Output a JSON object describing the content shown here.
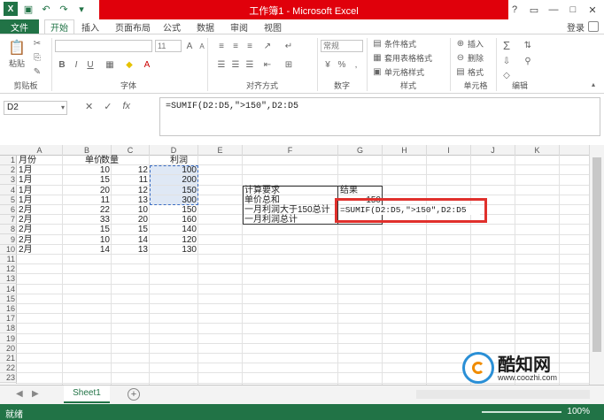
{
  "window": {
    "title": "工作簿1 - Microsoft Excel",
    "signin": "登录"
  },
  "tabs": [
    "文件",
    "开始",
    "插入",
    "页面布局",
    "公式",
    "数据",
    "审阅",
    "视图"
  ],
  "ribbon": {
    "clipboard": {
      "paste": "粘贴",
      "label": "剪贴板"
    },
    "font": {
      "size": "11",
      "label": "字体"
    },
    "alignment": {
      "label": "对齐方式"
    },
    "number": {
      "format": "常规",
      "label": "数字"
    },
    "styles": {
      "conditional": "条件格式",
      "table": "套用表格格式",
      "cell": "单元格样式",
      "label": "样式"
    },
    "cells": {
      "insert": "插入",
      "delete": "删除",
      "format": "格式",
      "label": "单元格"
    },
    "editing": {
      "label": "编辑"
    }
  },
  "formula_bar": {
    "namebox": "D2",
    "formula": "=SUMIF(D2:D5,\">150\",D2:D5"
  },
  "grid": {
    "columns": [
      "A",
      "B",
      "C",
      "D",
      "E",
      "F",
      "G",
      "H",
      "I",
      "J",
      "K"
    ],
    "rows": [
      "1",
      "2",
      "3",
      "4",
      "5",
      "6",
      "7",
      "8",
      "9",
      "10",
      "11",
      "12",
      "13",
      "14",
      "15",
      "16",
      "17",
      "18",
      "19",
      "20",
      "21",
      "22",
      "23"
    ],
    "data": {
      "headers": [
        "月份",
        "单价",
        "数量",
        "利润"
      ],
      "records": [
        [
          "1月",
          "10",
          "12",
          "100"
        ],
        [
          "1月",
          "15",
          "11",
          "200"
        ],
        [
          "1月",
          "20",
          "12",
          "150"
        ],
        [
          "1月",
          "11",
          "13",
          "300"
        ],
        [
          "2月",
          "22",
          "10",
          "150"
        ],
        [
          "2月",
          "33",
          "20",
          "160"
        ],
        [
          "2月",
          "15",
          "15",
          "140"
        ],
        [
          "2月",
          "10",
          "14",
          "120"
        ],
        [
          "2月",
          "14",
          "13",
          "130"
        ]
      ]
    },
    "side_table": {
      "col_f": [
        "计算要求",
        "单价总和",
        "一月利润大于150总计",
        "一月利润总计"
      ],
      "g_header": "结果",
      "g_row2": "150",
      "g_row3": "=SUMIF(D2:D5,\">150\",D2:D5"
    }
  },
  "sheets": [
    "Sheet1"
  ],
  "status": {
    "ready": "就绪",
    "zoom": "100%"
  },
  "watermark": {
    "name": "酷知网",
    "url": "www.coozhi.com"
  }
}
